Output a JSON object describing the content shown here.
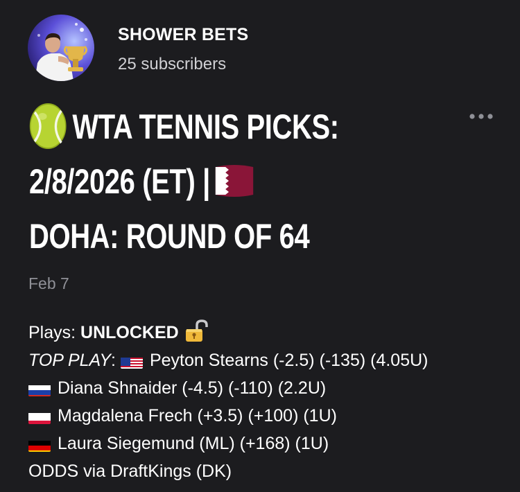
{
  "channel": {
    "name": "SHOWER BETS",
    "subscribers": "25 subscribers",
    "avatar_icon": "avatar-trophy-player"
  },
  "post": {
    "title_line1": "WTA TENNIS PICKS:",
    "title_line2": "2/8/2026 (ET) |",
    "title_line3": "DOHA: ROUND OF 64",
    "title_icon": "tennis-ball-icon",
    "title_flag": "qatar-flag-icon",
    "date": "Feb 7",
    "plays_label": "Plays:",
    "plays_status": "UNLOCKED",
    "top_play_label": "TOP PLAY",
    "top_play_colon": ":",
    "picks": [
      {
        "flag": "usa-flag-icon",
        "text": "Peyton Stearns (-2.5) (-135) (4.05U)"
      },
      {
        "flag": "russia-flag-icon",
        "text": "Diana Shnaider (-4.5) (-110) (2.2U)"
      },
      {
        "flag": "poland-flag-icon",
        "text": "Magdalena Frech (+3.5) (+100) (1U)"
      },
      {
        "flag": "germany-flag-icon",
        "text": "Laura Siegemund (ML) (+168) (1U)"
      }
    ],
    "odds_note": "ODDS via DraftKings (DK)"
  },
  "colors": {
    "background": "#1c1c1f",
    "text": "#ffffff",
    "muted": "#8f9097"
  }
}
